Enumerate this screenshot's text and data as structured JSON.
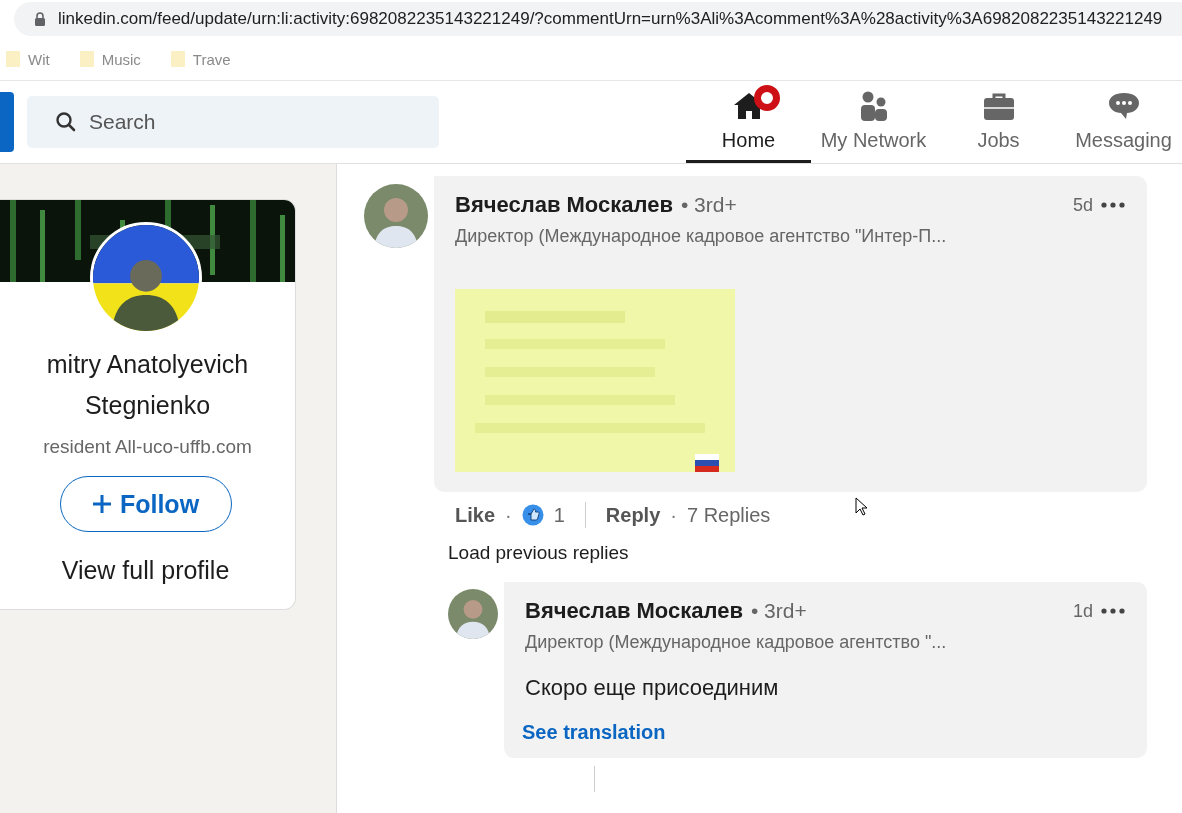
{
  "browser": {
    "url": "linkedin.com/feed/update/urn:li:activity:6982082235143221249/?commentUrn=urn%3Ali%3Acomment%3A%28activity%3A6982082235143221249",
    "bookmarks": [
      {
        "label": "Wit"
      },
      {
        "label": "Music"
      },
      {
        "label": "Trave"
      }
    ]
  },
  "nav": {
    "search_placeholder": "Search",
    "items": [
      {
        "label": "Home",
        "kind": "home",
        "selected": true,
        "notification": true
      },
      {
        "label": "My Network",
        "kind": "network",
        "selected": false,
        "notification": false
      },
      {
        "label": "Jobs",
        "kind": "jobs",
        "selected": false,
        "notification": false
      },
      {
        "label": "Messaging",
        "kind": "messaging",
        "selected": false,
        "notification": false
      }
    ]
  },
  "profile": {
    "name": "mitry Anatolyevich Stegnienko",
    "headline": "resident All-uco-uffb.com",
    "follow": "Follow",
    "view_profile": "View full profile"
  },
  "comment": {
    "author": "Вячеслав Москалев",
    "degree": "• 3rd+",
    "headline": "Директор (Международное кадровое агентство \"Интер-П...",
    "time": "5d",
    "actions": [
      {
        "kind": "like",
        "label": "Like"
      },
      {
        "kind": "sep",
        "label": "·"
      },
      {
        "kind": "reactions",
        "label": "1"
      },
      {
        "kind": "divider"
      },
      {
        "kind": "reply",
        "label": "Reply"
      },
      {
        "kind": "sep",
        "label": "·"
      },
      {
        "kind": "count",
        "label": "7 Replies"
      }
    ]
  },
  "load_previous": "Load previous replies",
  "reply": {
    "author": "Вячеслав Москалев",
    "degree": "• 3rd+",
    "headline": "Директор (Международное кадровое агентство \"...",
    "time": "1d",
    "text": "Скоро еще присоединим",
    "translate": "See translation"
  }
}
